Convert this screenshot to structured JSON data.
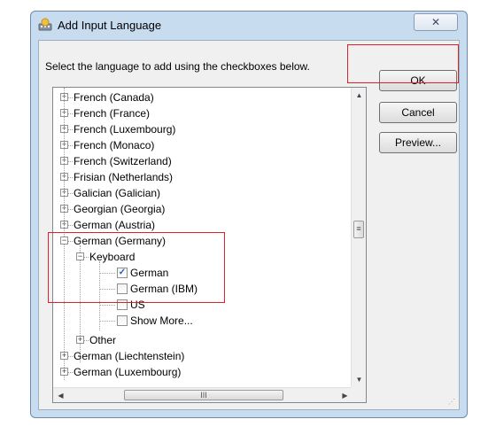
{
  "window": {
    "title": "Add Input Language",
    "close_glyph": "✕"
  },
  "instruction": "Select the language to add using the checkboxes below.",
  "buttons": {
    "ok": "OK",
    "cancel": "Cancel",
    "preview": "Preview..."
  },
  "tree": {
    "languages_top": [
      "French (Canada)",
      "French (France)",
      "French (Luxembourg)",
      "French (Monaco)",
      "French (Switzerland)",
      "Frisian (Netherlands)",
      "Galician (Galician)",
      "Georgian (Georgia)",
      "German (Austria)"
    ],
    "expanded_language": "German (Germany)",
    "keyboard_label": "Keyboard",
    "keyboards": [
      {
        "label": "German",
        "checked": true
      },
      {
        "label": "German (IBM)",
        "checked": false
      },
      {
        "label": "US",
        "checked": false
      },
      {
        "label": "Show More...",
        "checked": false
      }
    ],
    "other_label": "Other",
    "languages_bottom": [
      "German (Liechtenstein)",
      "German (Luxembourg)"
    ]
  },
  "scrollbar": {
    "thumb_glyph": "≡",
    "hthumb_glyph": "III"
  },
  "colors": {
    "highlight": "#d9222a",
    "check": "#2a5fb0",
    "title_bar": "#c8dcf0"
  }
}
